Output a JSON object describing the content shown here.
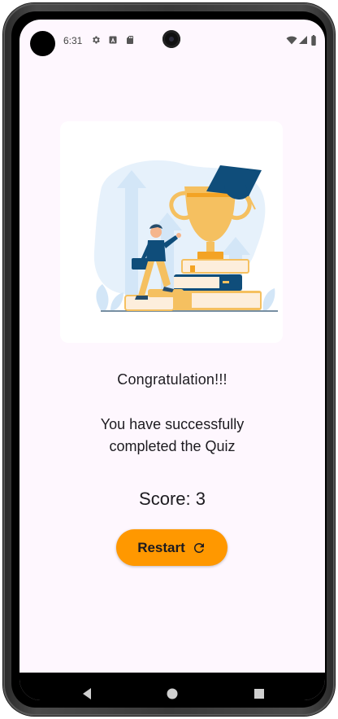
{
  "status_bar": {
    "time": "6:31",
    "icons": [
      "settings-icon",
      "font-icon",
      "sd-card-icon",
      "wifi-icon",
      "signal-icon",
      "battery-icon"
    ]
  },
  "illustration": {
    "description_name": "trophy-graduation-illustration",
    "colors": {
      "accent": "#f5c060",
      "navy": "#0f4d7a",
      "light_blue": "#e6f1fb"
    }
  },
  "result": {
    "heading": "Congratulation!!!",
    "message": "You have successfully completed the Quiz",
    "score_label": "Score: 3"
  },
  "actions": {
    "restart_label": "Restart",
    "restart_icon": "refresh-icon",
    "restart_color": "#ff9800"
  },
  "nav_bar": {
    "items": [
      "back-icon",
      "home-icon",
      "recents-icon"
    ]
  }
}
